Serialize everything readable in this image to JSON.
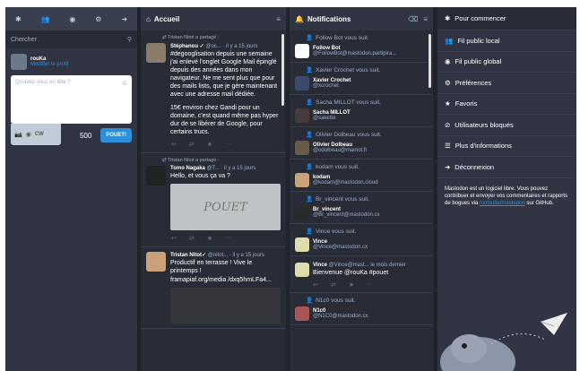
{
  "left": {
    "search_placeholder": "Chercher",
    "user": {
      "name": "rouKa",
      "edit": "Modifier le profil"
    },
    "compose_placeholder": "Qu'avez-vous en tête ?",
    "cw": "CW",
    "char_count": "500",
    "toot_label": "POUET!"
  },
  "home": {
    "title": "Accueil",
    "statuses": [
      {
        "boost": "Tristan Nitot a partagé :",
        "name": "Stéphanou ✓",
        "handle": "@oc...",
        "time": "il y a 15 jours",
        "content": "#degooglisation depuis une semaine j'ai enlevé l'onglet Google Mail épinglé depuis des années dans mon navigateur. Ne me sent plus que pour des mails lists, que je gère maintenant avec une adresse mail dédiée.",
        "content2": "15€ environ chez Gandi pour un domaine, c'est quand même pas hyper dur de se libérer de Google, pour certains trucs."
      },
      {
        "boost": "Tristan Nitot a partagé :",
        "name": "Tomo Nagaka",
        "handle": "@T...",
        "time": "il y a 15 jours",
        "content": "Hello, et vous ça va ?",
        "media_text": "POUET"
      },
      {
        "name": "Tristan Nitot✓",
        "handle": "@nitot...",
        "time": "il y a 15 jours",
        "content": "Productif en terrasse ! Vive le printemps !",
        "link": "framapiaf.org/media /dxq5hmLFa4..."
      }
    ]
  },
  "notifications": {
    "title": "Notifications",
    "items": [
      {
        "title": "Follow Bot vous suit.",
        "name": "Follow Bot",
        "handle": "@FollowBot@mastodon.partipira..."
      },
      {
        "title": "Xavier Crochet vous suit.",
        "name": "Xavier Crochet",
        "handle": "@xcrochet"
      },
      {
        "title": "Sacha MILLOT vous suit.",
        "name": "Sacha MILLOT",
        "handle": "@sakette"
      },
      {
        "title": "Olivier Dolbeau vous suit.",
        "name": "Olivier Dolbeau",
        "handle": "@odolbeau@mamot.fr"
      },
      {
        "title": "kodam vous suit.",
        "name": "kodam",
        "handle": "@kodam@mastodon.cloud"
      },
      {
        "title": "Br_vincent vous suit.",
        "name": "Br_vincent",
        "handle": "@Br_vincent@mastodon.cx"
      },
      {
        "title": "Vince vous suit.",
        "name": "Vince",
        "handle": "@Vince@mastodon.cx"
      },
      {
        "title": "N1c0 vous suit.",
        "name": "N1c0",
        "handle": "@N1C0@mastodon.cx"
      }
    ],
    "mention": {
      "name": "Vince",
      "handle": "@Vince@mast...",
      "time": "le mois dernier",
      "content": "Bienvenue @rouKa #pouet"
    }
  },
  "menu": {
    "items": [
      "Pour commencer",
      "Fil public local",
      "Fil public global",
      "Préférences",
      "Favoris",
      "Utilisateurs bloqués",
      "Plus d'informations",
      "Déconnexion"
    ],
    "about_text": "Mastodon est un logiciel libre. Vous pouvez contribuer et envoyer vos commentaires et rapports de bogues via",
    "about_link": "tootsuite/mastodon",
    "about_suffix": "sur GitHub."
  }
}
